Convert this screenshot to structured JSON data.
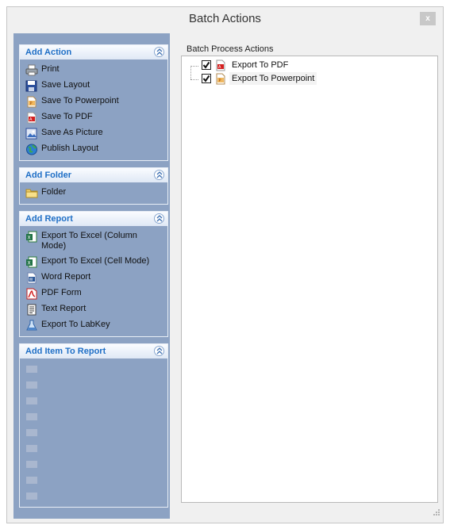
{
  "window": {
    "title": "Batch Actions",
    "close_label": "x"
  },
  "groups": [
    {
      "header": "Add Action",
      "items": [
        {
          "label": "Print",
          "icon": "printer-icon",
          "enabled": true
        },
        {
          "label": "Save Layout",
          "icon": "floppy-icon",
          "enabled": true
        },
        {
          "label": "Save To Powerpoint",
          "icon": "powerpoint-icon",
          "enabled": true
        },
        {
          "label": "Save To PDF",
          "icon": "pdf-icon",
          "enabled": true
        },
        {
          "label": "Save As Picture",
          "icon": "picture-icon",
          "enabled": true
        },
        {
          "label": "Publish Layout",
          "icon": "globe-icon",
          "enabled": true
        }
      ]
    },
    {
      "header": "Add Folder",
      "items": [
        {
          "label": "Folder",
          "icon": "folder-icon",
          "enabled": true
        }
      ]
    },
    {
      "header": "Add Report",
      "items": [
        {
          "label": "Export To Excel (Column Mode)",
          "icon": "excel-icon",
          "enabled": true
        },
        {
          "label": "Export To Excel (Cell Mode)",
          "icon": "excel-icon",
          "enabled": true
        },
        {
          "label": "Word Report",
          "icon": "word-icon",
          "enabled": true
        },
        {
          "label": "PDF Form",
          "icon": "pdf-form-icon",
          "enabled": true
        },
        {
          "label": "Text Report",
          "icon": "text-report-icon",
          "enabled": true
        },
        {
          "label": "Export To LabKey",
          "icon": "labkey-icon",
          "enabled": true
        }
      ]
    },
    {
      "header": "Add Item To Report",
      "items": [
        {
          "label": "",
          "icon": "disabled-item-icon",
          "enabled": false
        },
        {
          "label": "",
          "icon": "disabled-item-icon",
          "enabled": false
        },
        {
          "label": "",
          "icon": "disabled-item-icon",
          "enabled": false
        },
        {
          "label": "",
          "icon": "disabled-item-icon",
          "enabled": false
        },
        {
          "label": "",
          "icon": "disabled-item-icon",
          "enabled": false
        },
        {
          "label": "",
          "icon": "disabled-item-icon",
          "enabled": false
        },
        {
          "label": "",
          "icon": "disabled-item-icon",
          "enabled": false
        },
        {
          "label": "",
          "icon": "disabled-item-icon",
          "enabled": false
        },
        {
          "label": "",
          "icon": "disabled-item-icon",
          "enabled": false
        }
      ]
    }
  ],
  "batch": {
    "title": "Batch Process Actions",
    "items": [
      {
        "label": "Export To PDF",
        "checked": true,
        "icon": "pdf-icon"
      },
      {
        "label": "Export To Powerpoint",
        "checked": true,
        "icon": "powerpoint-icon",
        "selected": true
      }
    ]
  },
  "colors": {
    "panel_bg": "#8ca2c3",
    "header_text": "#1f6fc6",
    "disabled_text": "#a9b7cf"
  }
}
